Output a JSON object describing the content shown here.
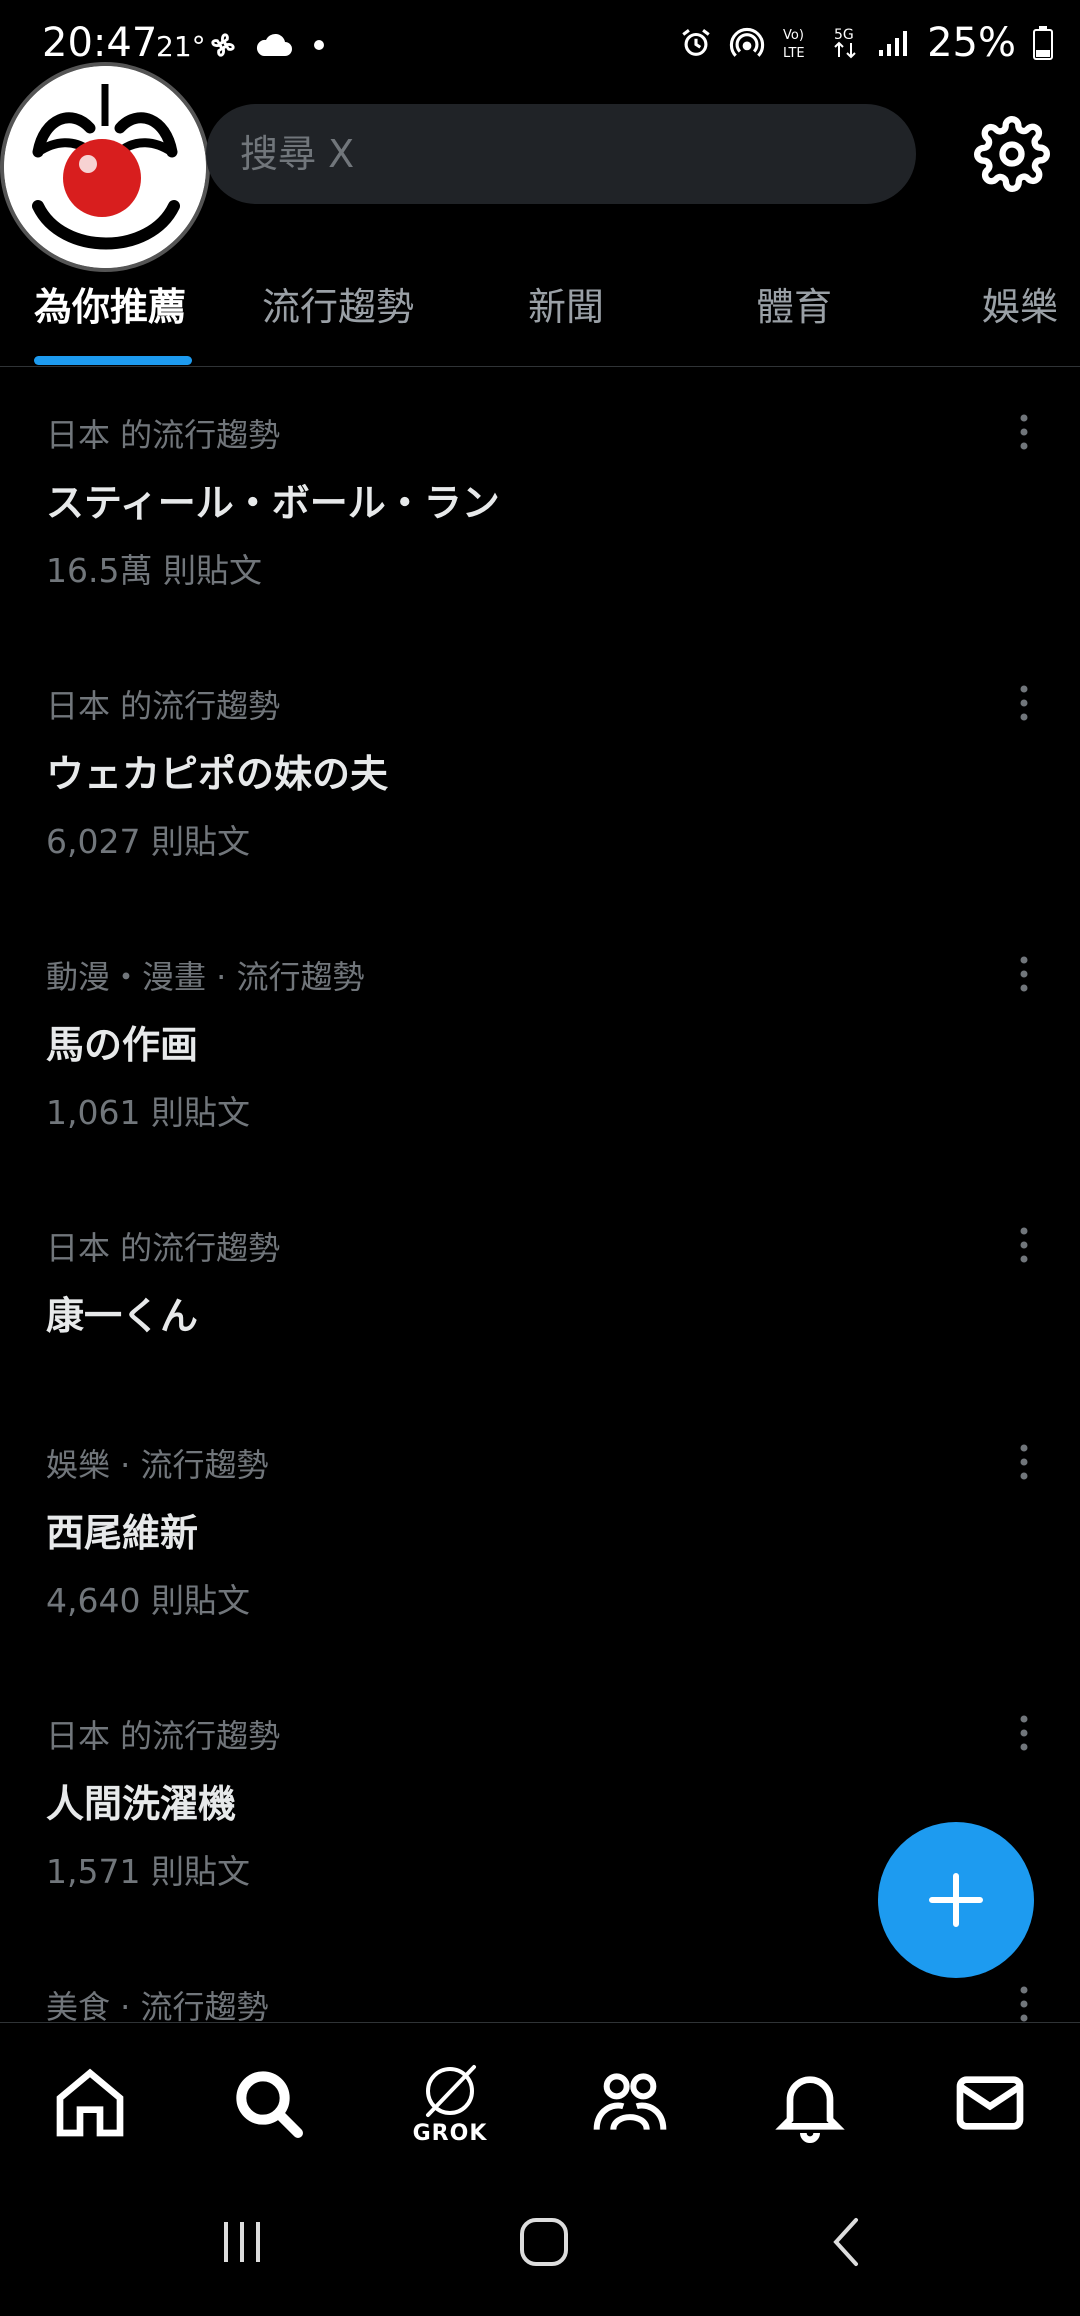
{
  "status_bar": {
    "time": "20:47",
    "temperature": "21°",
    "battery": "25%"
  },
  "search": {
    "placeholder": "搜尋 X"
  },
  "tabs": [
    {
      "label": "為你推薦",
      "active": true
    },
    {
      "label": "流行趨勢",
      "active": false
    },
    {
      "label": "新聞",
      "active": false
    },
    {
      "label": "體育",
      "active": false
    },
    {
      "label": "娛樂",
      "active": false
    }
  ],
  "trends": [
    {
      "context": "日本 的流行趨勢",
      "title": "スティール・ボール・ラン",
      "count": "16.5萬 則貼文"
    },
    {
      "context": "日本 的流行趨勢",
      "title": "ウェカピポの妹の夫",
      "count": "6,027 則貼文"
    },
    {
      "context": "動漫・漫畫 · 流行趨勢",
      "title": "馬の作画",
      "count": "1,061 則貼文"
    },
    {
      "context": "日本 的流行趨勢",
      "title": "康一くん",
      "count": ""
    },
    {
      "context": "娛樂 · 流行趨勢",
      "title": "西尾維新",
      "count": "4,640 則貼文"
    },
    {
      "context": "日本 的流行趨勢",
      "title": "人間洗濯機",
      "count": "1,571 則貼文"
    },
    {
      "context": "美食 · 流行趨勢",
      "title": "",
      "count": ""
    }
  ],
  "bottom_nav": {
    "items": [
      "home-icon",
      "search-icon",
      "grok-icon",
      "communities-icon",
      "notifications-icon",
      "messages-icon"
    ],
    "grok_label": "GROK"
  },
  "colors": {
    "accent": "#1d9bf0",
    "background": "#000000",
    "secondary_text": "#71767b",
    "primary_text": "#e7e9ea"
  }
}
